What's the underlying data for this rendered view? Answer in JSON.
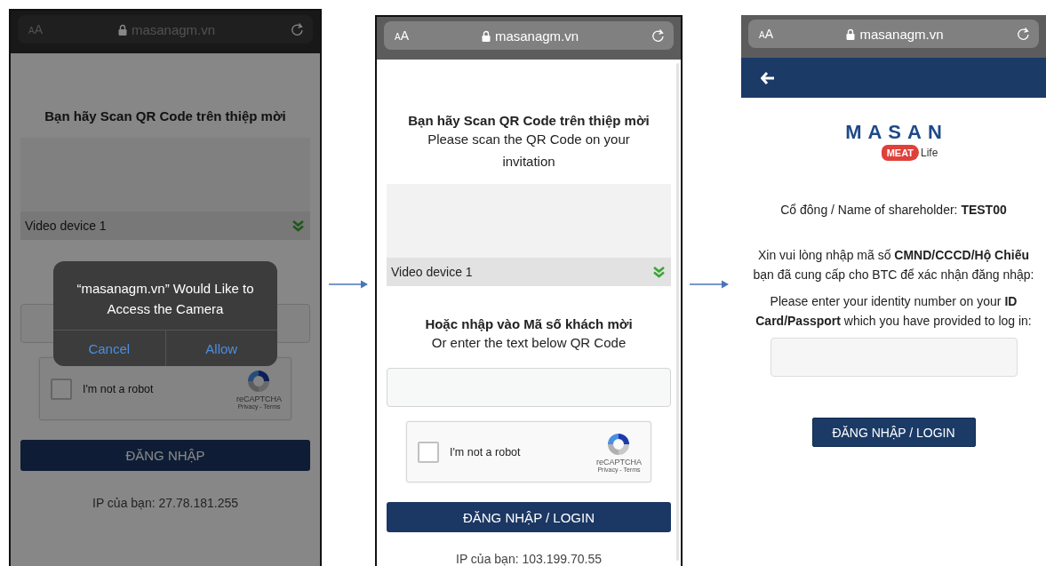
{
  "screens": [
    {
      "kind": "scan",
      "url": "masanagm.vn",
      "text_size": "AA",
      "dimmed": true,
      "heading": "Bạn hãy Scan QR Code trên thiệp mời",
      "device": "Video device 1",
      "captcha": {
        "label": "I'm not a robot",
        "brand": "reCAPTCHA",
        "links": "Privacy - Terms",
        "checked": false
      },
      "login_button": "ĐĂNG NHẬP",
      "ip": "IP của bạn: 27.78.181.255",
      "dialog": {
        "message": "“masanagm.vn” Would Like to Access the Camera",
        "buttons": [
          "Cancel",
          "Allow"
        ]
      }
    },
    {
      "kind": "scan",
      "url": "masanagm.vn",
      "text_size": "AA",
      "dimmed": false,
      "heading": "Bạn hãy Scan QR Code trên thiệp mời",
      "subheading": "Please scan the QR Code on your invitation",
      "device": "Video device 1",
      "code_heading": "Hoặc nhập vào Mã số khách mời",
      "code_subheading": "Or enter the text below QR Code",
      "captcha": {
        "label": "I'm not a robot",
        "brand": "reCAPTCHA",
        "links": "Privacy - Terms",
        "checked": false
      },
      "login_button": "ĐĂNG NHẬP / LOGIN",
      "ip": "IP của bạn: 103.199.70.55"
    },
    {
      "kind": "identity",
      "url": "masanagm.vn",
      "text_size": "AA",
      "logo": {
        "brand": "MASAN",
        "badge": "MEAT",
        "tagline": "Life"
      },
      "shareholder": "Cổ đông / Name of shareholder: **TEST00**",
      "prompt_vi": "Xin vui lòng nhập mã số **CMND/CCCD/Hộ Chiếu** bạn đã cung cấp cho BTC để xác nhận đăng nhập:",
      "prompt_en": "Please enter your identity number on your **ID Card/Passport** which you have provided to log in:",
      "login_button": "ĐĂNG NHẬP / LOGIN"
    }
  ]
}
